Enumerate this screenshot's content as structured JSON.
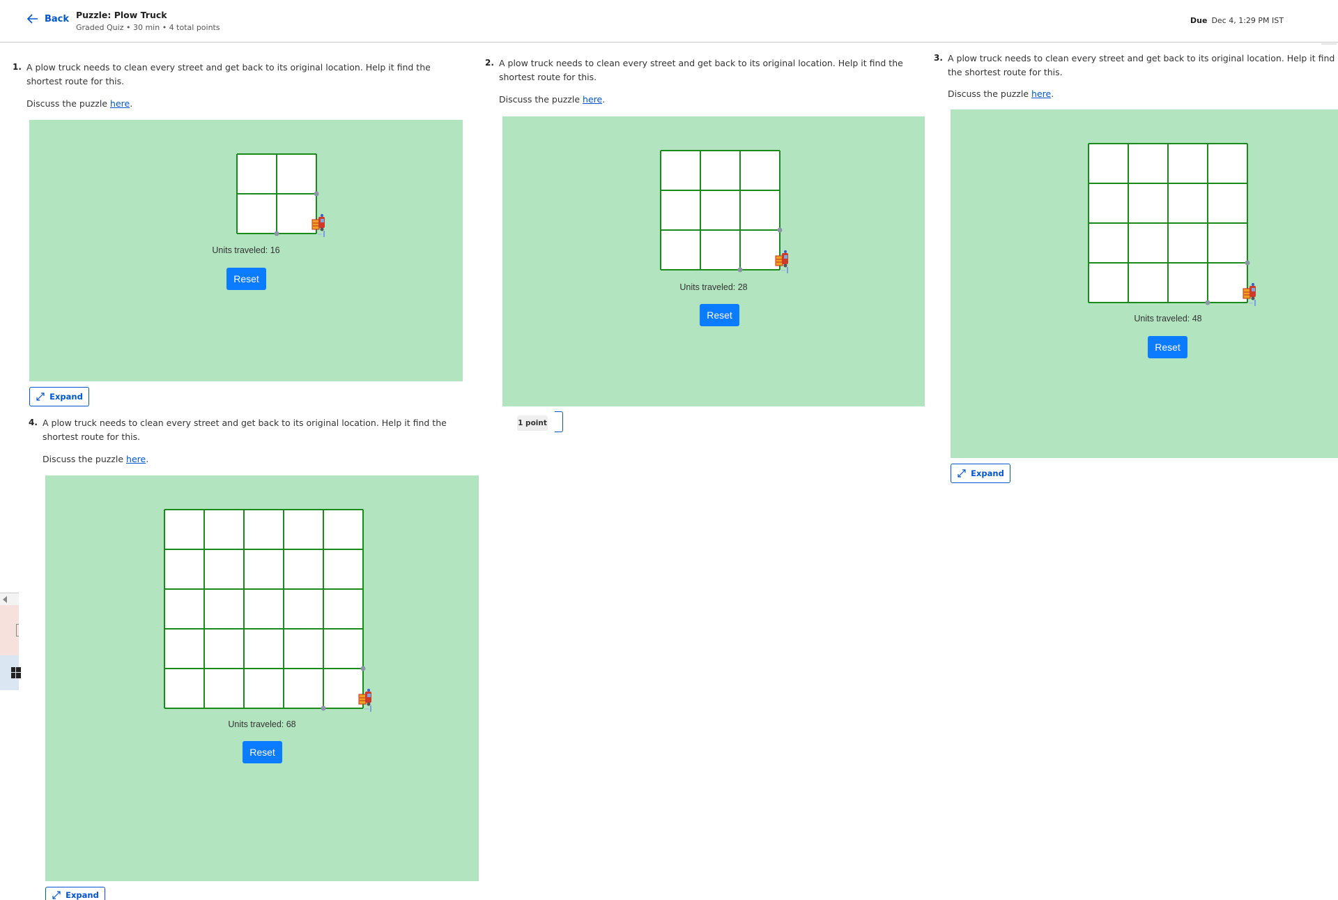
{
  "header": {
    "back_label": "Back",
    "title": "Puzzle: Plow Truck",
    "subtitle": "Graded Quiz • 30 min • 4 total points",
    "due_label": "Due",
    "due_value": "Dec 4, 1:29 PM IST"
  },
  "questions": [
    {
      "number": "1.",
      "text": "A plow truck needs to clean every street and get back to its original location. Help it find the shortest route for this.",
      "discuss_prefix": "Discuss the puzzle ",
      "discuss_link": "here",
      "discuss_suffix": ".",
      "grid_size": 2,
      "units_text": "Units traveled: 16",
      "reset_label": "Reset",
      "expand_label": "Expand"
    },
    {
      "number": "2.",
      "text": "A plow truck needs to clean every street and get back to its original location. Help it find the shortest route for this.",
      "discuss_prefix": "Discuss the puzzle ",
      "discuss_link": "here",
      "discuss_suffix": ".",
      "grid_size": 3,
      "units_text": "Units traveled: 28",
      "reset_label": "Reset",
      "points_label": "1 point"
    },
    {
      "number": "3.",
      "text": "A plow truck needs to clean every street and get back to its original location. Help it find the shortest route for this.",
      "discuss_prefix": "Discuss the puzzle ",
      "discuss_link": "here",
      "discuss_suffix": ".",
      "grid_size": 4,
      "units_text": "Units traveled: 48",
      "reset_label": "Reset",
      "expand_label": "Expand"
    },
    {
      "number": "4.",
      "text": "A plow truck needs to clean every street and get back to its original location. Help it find the shortest route for this.",
      "discuss_prefix": "Discuss the puzzle ",
      "discuss_link": "here",
      "discuss_suffix": ".",
      "grid_size": 5,
      "units_text": "Units traveled: 68",
      "reset_label": "Reset",
      "expand_label": "Expand"
    }
  ],
  "icons": {
    "back": "arrow-left-icon",
    "expand": "expand-arrows-icon",
    "truck": "plow-truck-icon",
    "windows": "windows-logo-icon"
  },
  "colors": {
    "board_bg": "#b2e4bf",
    "grid_line": "#1a8a1a",
    "button_blue": "#0b7bff",
    "link_blue": "#0056d2"
  }
}
